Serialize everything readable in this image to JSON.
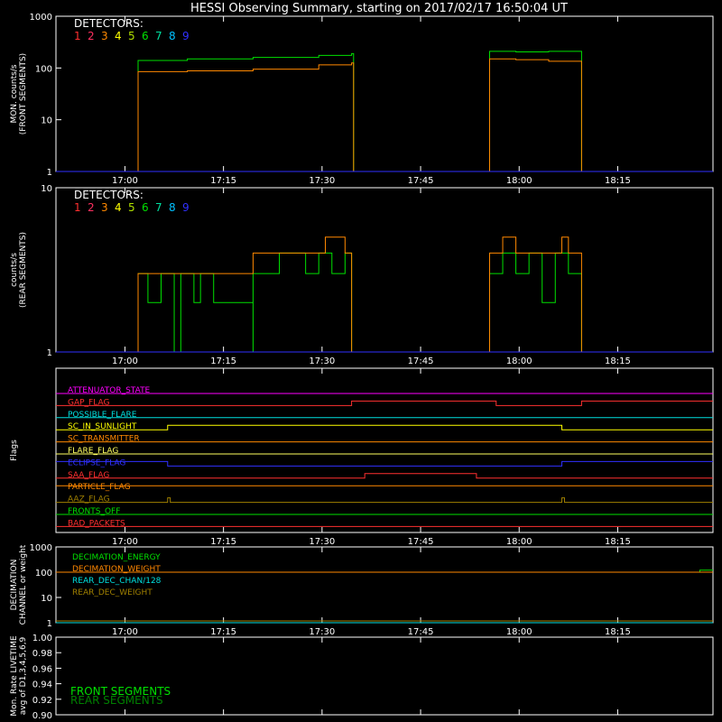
{
  "title": "HESSI Observing Summary, starting on 2017/02/17 16:50:04 UT",
  "colors": {
    "background": "#000000",
    "axis": "#ffffff",
    "det1": "#ff3030",
    "det2": "#ff3060",
    "det3": "#ff8800",
    "det4": "#ffff00",
    "det5": "#b0e000",
    "det6": "#00e000",
    "det7": "#00e0a0",
    "det8": "#00c0ff",
    "det9": "#3030ff"
  },
  "time_ticks": [
    "17:00",
    "17:15",
    "17:30",
    "17:45",
    "18:00",
    "18:15"
  ],
  "chart_data": [
    {
      "type": "line",
      "panel": "front",
      "ylabel": [
        "MON. counts/s",
        "(FRONT SEGMENTS)"
      ],
      "yscale": "log",
      "ylim": [
        1,
        1000
      ],
      "ytick_labels": [
        "1",
        "10",
        "100",
        "1000"
      ],
      "legend_title": "DETECTORS:",
      "legend_items": [
        "1",
        "2",
        "3",
        "4",
        "5",
        "6",
        "7",
        "8",
        "9"
      ],
      "x_units": "minutes after 16:50:04 UT",
      "series": [
        {
          "color_key": "det6",
          "points": [
            [
              0,
              1
            ],
            [
              12.5,
              1
            ],
            [
              12.5,
              140
            ],
            [
              20,
              150
            ],
            [
              30,
              160
            ],
            [
              40,
              175
            ],
            [
              45,
              190
            ],
            [
              45.3,
              1
            ],
            [
              55,
              1
            ],
            [
              66,
              1
            ],
            [
              66,
              210
            ],
            [
              70,
              205
            ],
            [
              75,
              210
            ],
            [
              80,
              200
            ],
            [
              80,
              1
            ],
            [
              100,
              1
            ]
          ]
        },
        {
          "color_key": "det3",
          "points": [
            [
              0,
              1
            ],
            [
              12.5,
              1
            ],
            [
              12.5,
              85
            ],
            [
              20,
              88
            ],
            [
              30,
              95
            ],
            [
              40,
              115
            ],
            [
              45,
              125
            ],
            [
              45.3,
              1
            ],
            [
              55,
              1
            ],
            [
              66,
              1
            ],
            [
              66,
              150
            ],
            [
              70,
              145
            ],
            [
              75,
              135
            ],
            [
              80,
              130
            ],
            [
              80,
              1
            ],
            [
              100,
              1
            ]
          ]
        },
        {
          "color_key": "det9",
          "points": [
            [
              0,
              1
            ],
            [
              100,
              1
            ]
          ]
        }
      ]
    },
    {
      "type": "line",
      "panel": "rear",
      "ylabel": [
        "counts/s",
        "(REAR SEGMENTS)"
      ],
      "yscale": "log",
      "ylim": [
        1,
        10
      ],
      "ytick_labels": [
        "1",
        "10"
      ],
      "legend_title": "DETECTORS:",
      "legend_items": [
        "1",
        "2",
        "3",
        "4",
        "5",
        "6",
        "7",
        "8",
        "9"
      ],
      "series": [
        {
          "color_key": "det6",
          "points": [
            [
              0,
              1
            ],
            [
              12.5,
              1
            ],
            [
              12.5,
              3
            ],
            [
              14,
              2
            ],
            [
              16,
              3
            ],
            [
              18,
              1
            ],
            [
              19,
              3
            ],
            [
              21,
              2
            ],
            [
              22,
              3
            ],
            [
              24,
              2
            ],
            [
              28,
              2
            ],
            [
              30,
              1
            ],
            [
              30,
              3
            ],
            [
              33,
              3
            ],
            [
              34,
              4
            ],
            [
              38,
              3
            ],
            [
              40,
              4
            ],
            [
              42,
              3
            ],
            [
              44,
              4
            ],
            [
              45,
              1
            ],
            [
              66,
              1
            ],
            [
              66,
              3
            ],
            [
              68,
              4
            ],
            [
              70,
              3
            ],
            [
              72,
              4
            ],
            [
              74,
              2
            ],
            [
              76,
              4
            ],
            [
              78,
              3
            ],
            [
              80,
              3
            ],
            [
              80,
              1
            ],
            [
              100,
              1
            ]
          ]
        },
        {
          "color_key": "det3",
          "points": [
            [
              0,
              1
            ],
            [
              12.5,
              1
            ],
            [
              12.5,
              3
            ],
            [
              16,
              3
            ],
            [
              20,
              3
            ],
            [
              26,
              3
            ],
            [
              29,
              3
            ],
            [
              30,
              4
            ],
            [
              34,
              4
            ],
            [
              38,
              4
            ],
            [
              41,
              5
            ],
            [
              44,
              4
            ],
            [
              45,
              1
            ],
            [
              66,
              1
            ],
            [
              66,
              4
            ],
            [
              68,
              5
            ],
            [
              70,
              4
            ],
            [
              75,
              4
            ],
            [
              77,
              5
            ],
            [
              78,
              4
            ],
            [
              80,
              4
            ],
            [
              80,
              1
            ],
            [
              100,
              1
            ]
          ]
        },
        {
          "color_key": "det9",
          "points": [
            [
              0,
              1
            ],
            [
              100,
              1
            ]
          ]
        }
      ]
    },
    {
      "type": "line",
      "panel": "flags",
      "ylabel": "Flags",
      "flags": [
        {
          "label": "ATTENUATOR_STATE",
          "color_key": "magenta",
          "color": "#ff00ff",
          "steps": [
            [
              0,
              0
            ],
            [
              100,
              0
            ]
          ]
        },
        {
          "label": "GAP_FLAG",
          "color": "#ff3030",
          "steps": [
            [
              0,
              0
            ],
            [
              45,
              1
            ],
            [
              67,
              0
            ],
            [
              80,
              1
            ],
            [
              100,
              1
            ]
          ]
        },
        {
          "label": "POSSIBLE_FLARE",
          "color": "#00e0e0",
          "steps": [
            [
              0,
              0
            ],
            [
              100,
              0
            ]
          ]
        },
        {
          "label": "SC_IN_SUNLIGHT",
          "color": "#ffff00",
          "steps": [
            [
              0,
              0
            ],
            [
              17,
              1
            ],
            [
              77,
              0
            ],
            [
              100,
              0
            ]
          ]
        },
        {
          "label": "SC_TRANSMITTER",
          "color": "#ff8800",
          "steps": [
            [
              0,
              0
            ],
            [
              100,
              0
            ]
          ]
        },
        {
          "label": "FLARE_FLAG",
          "color": "#ffff60",
          "steps": [
            [
              0,
              0
            ],
            [
              100,
              0
            ]
          ]
        },
        {
          "label": "ECLIPSE_FLAG",
          "color": "#3030ff",
          "steps": [
            [
              0,
              1
            ],
            [
              17,
              0
            ],
            [
              77,
              1
            ],
            [
              100,
              1
            ]
          ]
        },
        {
          "label": "SAA_FLAG",
          "color": "#ff3030",
          "steps": [
            [
              0,
              0
            ],
            [
              47,
              1
            ],
            [
              64,
              0
            ],
            [
              100,
              0
            ]
          ]
        },
        {
          "label": "PARTICLE_FLAG",
          "color": "#ff8800",
          "steps": [
            [
              0,
              1
            ],
            [
              100,
              1
            ]
          ]
        },
        {
          "label": "AAZ_FLAG",
          "color": "#a08000",
          "steps": [
            [
              0,
              0
            ],
            [
              17,
              1
            ],
            [
              17.4,
              0
            ],
            [
              77,
              1
            ],
            [
              77.4,
              0
            ],
            [
              100,
              0
            ]
          ]
        },
        {
          "label": "FRONTS_OFF",
          "color": "#00e000",
          "steps": [
            [
              0,
              0
            ],
            [
              100,
              0
            ]
          ]
        },
        {
          "label": "BAD_PACKETS",
          "color": "#ff3030",
          "steps": [
            [
              0,
              0
            ],
            [
              100,
              0
            ]
          ]
        }
      ]
    },
    {
      "type": "line",
      "panel": "decimation",
      "ylabel": [
        "DECIMATION",
        "CHANNEL or weight"
      ],
      "yscale": "log",
      "ylim": [
        1,
        1000
      ],
      "ytick_labels": [
        "1",
        "10",
        "100",
        "1000"
      ],
      "series": [
        {
          "name": "DECIMATION_ENERGY",
          "color": "#00e000",
          "points": [
            [
              0,
              100
            ],
            [
              98,
              100
            ],
            [
              98,
              120
            ],
            [
              100,
              120
            ]
          ]
        },
        {
          "name": "DECIMATION_WEIGHT",
          "color": "#ff8800",
          "points": [
            [
              0,
              100
            ],
            [
              100,
              100
            ]
          ]
        },
        {
          "name": "REAR_DEC_CHAN/128",
          "color": "#00e0e0",
          "points": [
            [
              0,
              1
            ],
            [
              100,
              1
            ]
          ]
        },
        {
          "name": "REAR_DEC_WEIGHT",
          "color": "#a08000",
          "points": [
            [
              0,
              1
            ],
            [
              100,
              1
            ]
          ]
        }
      ]
    },
    {
      "type": "line",
      "panel": "livetime",
      "ylabel": [
        "Mon. Rate LIVETIME",
        "avg of D1,3,4,5,6,9"
      ],
      "ylim": [
        0.9,
        1.0
      ],
      "ytick_labels": [
        "0.90",
        "0.92",
        "0.94",
        "0.96",
        "0.98",
        "1.00"
      ],
      "series": [
        {
          "name": "FRONT SEGMENTS",
          "color": "#00e000",
          "points": []
        },
        {
          "name": "REAR SEGMENTS",
          "color": "#008000",
          "points": []
        }
      ]
    }
  ]
}
